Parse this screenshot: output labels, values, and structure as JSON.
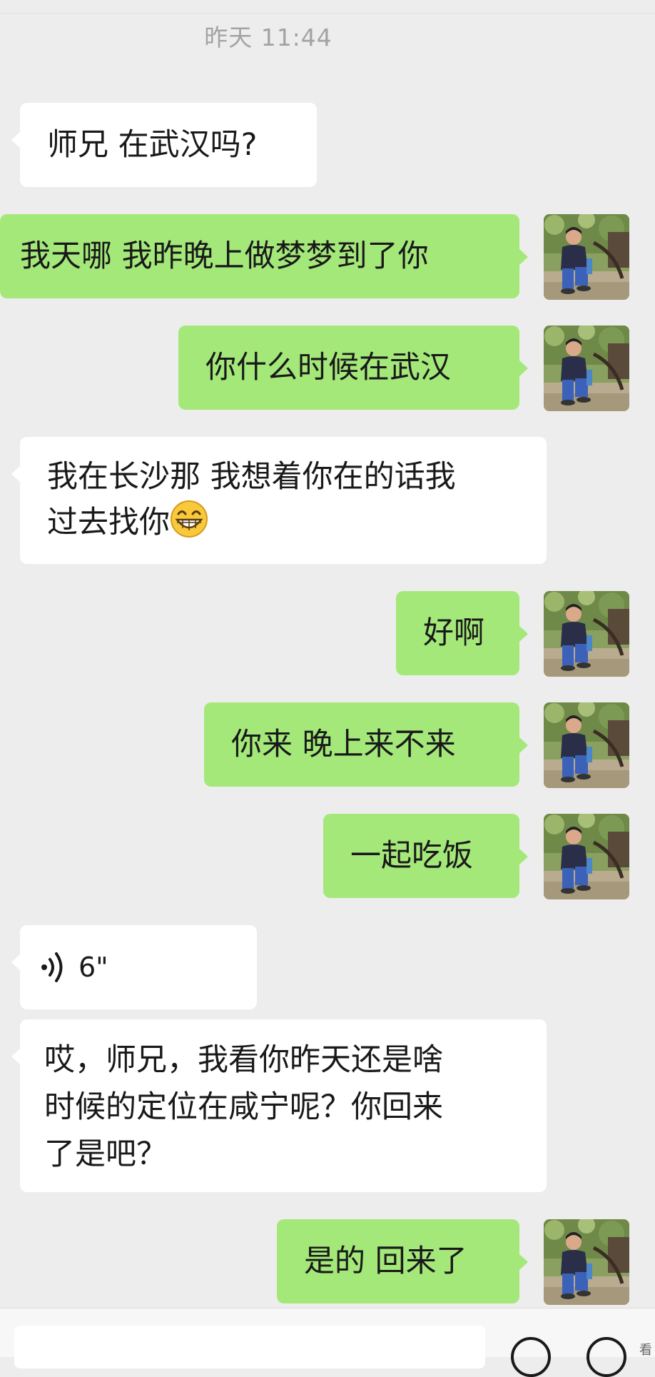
{
  "timestamp": "昨天 11:44",
  "messages": [
    {
      "side": "in",
      "text": "师兄 在武汉吗?"
    },
    {
      "side": "out",
      "text": "我天哪 我昨晚上做梦梦到了你"
    },
    {
      "side": "out",
      "text": "你什么时候在武汉"
    },
    {
      "side": "in",
      "line1": "我在长沙那 我想着你在的话我",
      "line2": "过去找你",
      "emoji": "grinning-emoji"
    },
    {
      "side": "out",
      "text": "好啊"
    },
    {
      "side": "out",
      "text": "你来 晚上来不来"
    },
    {
      "side": "out",
      "text": "一起吃饭"
    },
    {
      "side": "in",
      "type": "voice",
      "duration": "6\""
    },
    {
      "side": "in",
      "line1": "哎，师兄，我看你昨天还是啥",
      "line2": "时候的定位在咸宁呢？你回来",
      "line3": "了是吧？"
    },
    {
      "side": "out",
      "text": "是的 回来了"
    }
  ],
  "corner_text": "看",
  "colors": {
    "background": "#ededed",
    "incoming_bubble": "#ffffff",
    "outgoing_bubble": "#a4e87a",
    "timestamp": "#a3a3a3"
  }
}
